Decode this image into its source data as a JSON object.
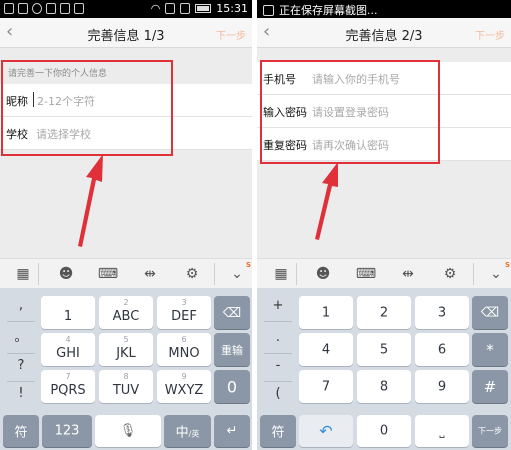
{
  "left": {
    "status": {
      "time": "15:31"
    },
    "title": "完善信息 1/3",
    "next": "下一步",
    "hint": "请完善一下你的个人信息",
    "fields": [
      {
        "label": "昵称",
        "placeholder": "2-12个字符"
      },
      {
        "label": "学校",
        "placeholder": "请选择学校"
      }
    ],
    "keyboard": {
      "col": [
        ",",
        "。",
        "?",
        "!"
      ],
      "row1": [
        {
          "sub": "",
          "main": "1"
        },
        {
          "sub": "2",
          "main": "ABC"
        },
        {
          "sub": "3",
          "main": "DEF"
        }
      ],
      "row2": [
        {
          "sub": "4",
          "main": "GHI"
        },
        {
          "sub": "5",
          "main": "JKL"
        },
        {
          "sub": "6",
          "main": "MNO"
        }
      ],
      "row3": [
        {
          "sub": "7",
          "main": "PQRS"
        },
        {
          "sub": "8",
          "main": "TUV"
        },
        {
          "sub": "9",
          "main": "WXYZ"
        }
      ],
      "reenter": "重输",
      "zero": "0",
      "sym": "符",
      "num": "123",
      "lang_main": "中",
      "lang_sub": "/英"
    }
  },
  "right": {
    "status": {
      "notice": "正在保存屏幕截图..."
    },
    "title": "完善信息 2/3",
    "next": "下一步",
    "fields": [
      {
        "label": "手机号",
        "placeholder": "请输入你的手机号"
      },
      {
        "label": "输入密码",
        "placeholder": "请设置登录密码"
      },
      {
        "label": "重复密码",
        "placeholder": "请再次确认密码"
      }
    ],
    "keyboard": {
      "col": [
        "+",
        ".",
        "-",
        "("
      ],
      "row1": [
        "1",
        "2",
        "3"
      ],
      "row2": [
        "4",
        "5",
        "6"
      ],
      "row3": [
        "7",
        "8",
        "9"
      ],
      "star": "*",
      "hash": "#",
      "zero": "0",
      "sym": "符",
      "next": "下一步"
    }
  },
  "colors": {
    "highlight": "#e0303a",
    "accent": "#f5b99a",
    "keyboard_bg": "#d5dbe3"
  }
}
